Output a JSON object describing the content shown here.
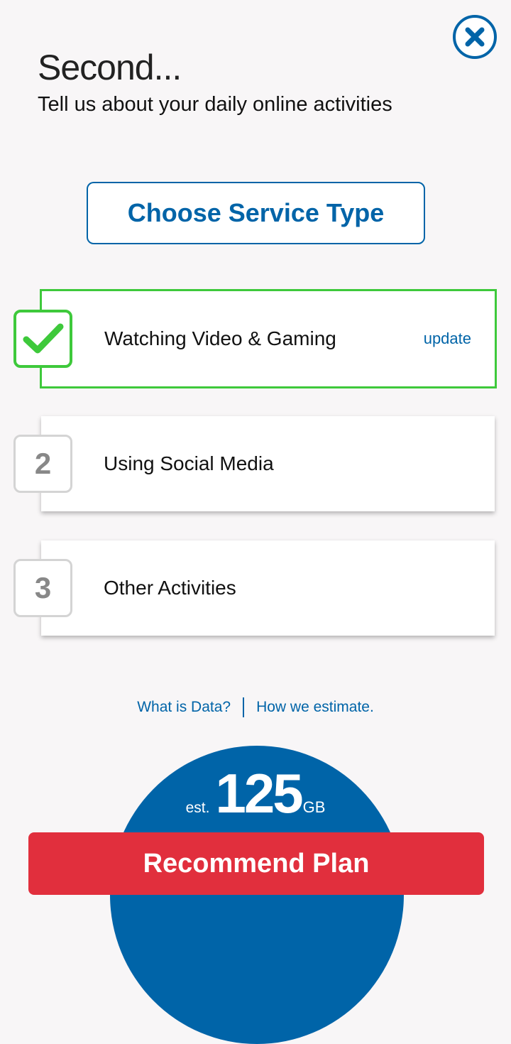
{
  "header": {
    "title": "Second...",
    "subtitle": "Tell us about your daily online activities"
  },
  "service_button": {
    "label": "Choose Service Type"
  },
  "activities": [
    {
      "step": "",
      "label": "Watching Video & Gaming",
      "status": "completed",
      "action": "update"
    },
    {
      "step": "2",
      "label": "Using Social Media",
      "status": "pending"
    },
    {
      "step": "3",
      "label": "Other Activities",
      "status": "pending"
    }
  ],
  "links": {
    "what_is_data": "What is Data?",
    "how_we_estimate": "How we estimate."
  },
  "estimate": {
    "prefix": "est.",
    "value": "125",
    "unit": "GB"
  },
  "recommend_button": {
    "label": "Recommend Plan"
  },
  "icons": {
    "close": "close-icon",
    "check": "check-icon"
  },
  "colors": {
    "brand_blue": "#0064a8",
    "success_green": "#3ec93b",
    "cta_red": "#e12f3d",
    "background": "#f8f6f7"
  }
}
